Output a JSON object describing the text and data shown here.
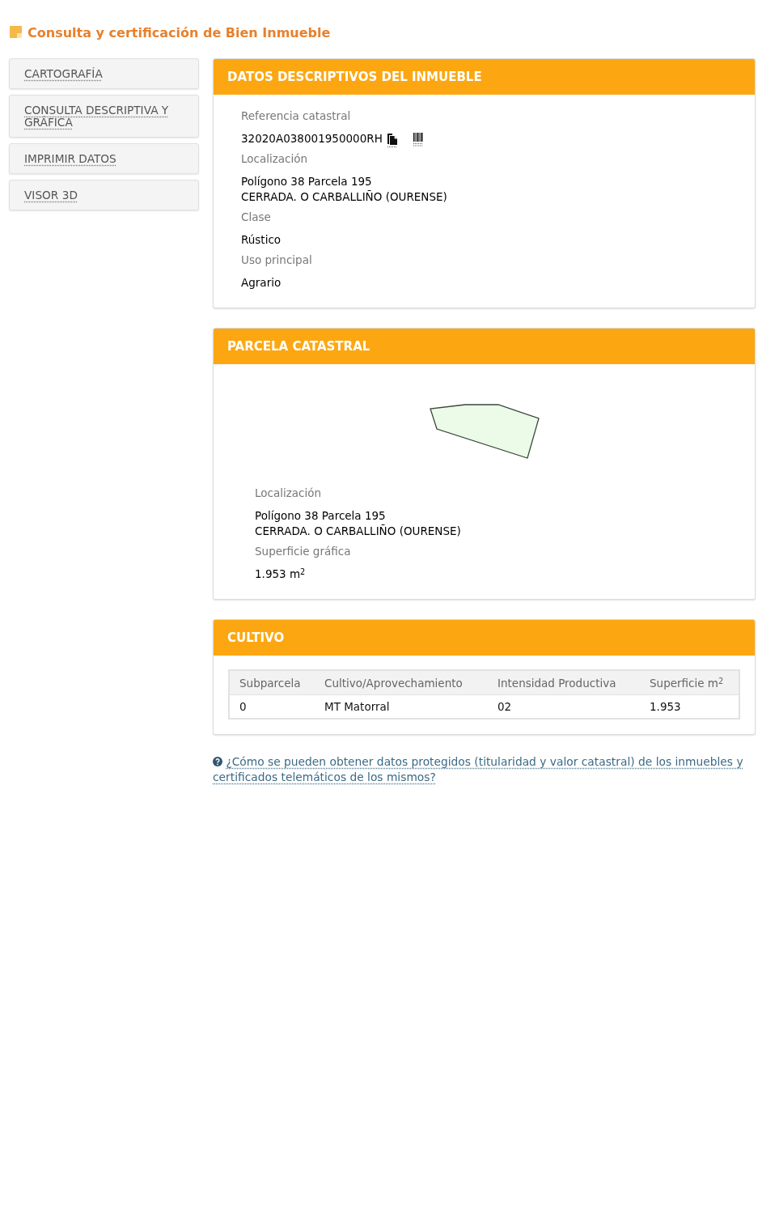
{
  "page_title": "Consulta y certificación de Bien Inmueble",
  "sidebar": {
    "items": [
      {
        "label": "CARTOGRAFÍA"
      },
      {
        "label": "CONSULTA DESCRIPTIVA Y GRÁFICA"
      },
      {
        "label": "IMPRIMIR DATOS"
      },
      {
        "label": "VISOR 3D"
      }
    ]
  },
  "panels": [
    {
      "kind": "fields",
      "title": "DATOS DESCRIPTIVOS DEL INMUEBLE",
      "fields": [
        {
          "kind": "reference",
          "label": "Referencia catastral",
          "lines": [
            "32020A038001950000RH"
          ]
        },
        {
          "kind": "text",
          "label": "Localización",
          "lines": [
            "Polígono 38 Parcela 195",
            "CERRADA. O CARBALLIÑO (OURENSE)"
          ]
        },
        {
          "kind": "text",
          "label": "Clase",
          "lines": [
            "Rústico"
          ]
        },
        {
          "kind": "text",
          "label": "Uso principal",
          "lines": [
            "Agrario"
          ]
        }
      ]
    },
    {
      "kind": "parcel",
      "title": "PARCELA CATASTRAL",
      "fields": [
        {
          "kind": "text",
          "label": "Localización",
          "lines": [
            "Polígono 38 Parcela 195",
            "CERRADA. O CARBALLIÑO (OURENSE)"
          ]
        },
        {
          "kind": "text",
          "label": "Superficie gráfica",
          "lines": [
            "1.953 m$^{2}$"
          ]
        }
      ]
    },
    {
      "kind": "table",
      "title": "CULTIVO",
      "table": {
        "columns": [
          "Subparcela",
          "Cultivo/Aprovechamiento",
          "Intensidad Productiva",
          "Superficie m$^{2}$"
        ],
        "rows": [
          [
            "0",
            "MT Matorral",
            "02",
            "1.953"
          ]
        ]
      }
    }
  ],
  "help_link": {
    "text": "¿Cómo se pueden obtener datos protegidos (titularidad y valor catastral) de los inmuebles y certificados telemáticos de los mismos?"
  }
}
